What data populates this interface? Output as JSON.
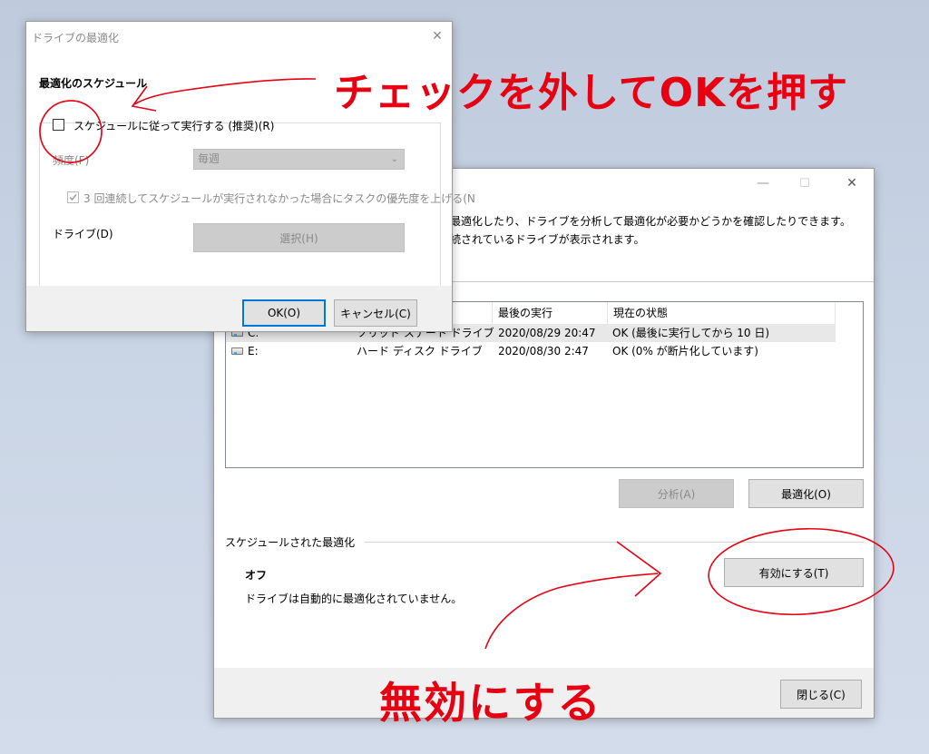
{
  "main_window": {
    "minimize_glyph": "—",
    "maximize_glyph": "☐",
    "close_glyph": "✕",
    "description_line1": "を最適化したり、ドライブを分析して最適化が必要かどうかを確認したりできます。",
    "description_line2": "接続されているドライブが表示されます。",
    "columns": {
      "last_run": "最後の実行",
      "current_status": "現在の状態"
    },
    "drives": [
      {
        "drive": "C:",
        "media_type": "ソリッド ステート ドライブ",
        "last_run": "2020/08/29 20:47",
        "status": "OK (最後に実行してから 10 日)"
      },
      {
        "drive": "E:",
        "media_type": "ハード ディスク ドライブ",
        "last_run": "2020/08/30 2:47",
        "status": "OK (0% が断片化しています)"
      }
    ],
    "analyze_label": "分析(A)",
    "optimize_label": "最適化(O)",
    "scheduled_section_label": "スケジュールされた最適化",
    "schedule_state": "オフ",
    "schedule_description": "ドライブは自動的に最適化されていません。",
    "enable_label": "有効にする(T)",
    "close_label": "閉じる(C)"
  },
  "schedule_dialog": {
    "title": "ドライブの最適化",
    "close_glyph": "✕",
    "section_heading": "最適化のスケジュール",
    "run_on_schedule_label": "スケジュールに従って実行する (推奨)(R)",
    "frequency_label": "頻度(F)",
    "frequency_value": "毎週",
    "priority_label": "3 回連続してスケジュールが実行されなかった場合にタスクの優先度を上げる(N",
    "drives_label": "ドライブ(D)",
    "select_label": "選択(H)",
    "ok_label": "OK(O)",
    "cancel_label": "キャンセル(C)"
  },
  "annotations": {
    "uncheck_instruction": "チェックを外してOKを押す",
    "disable_instruction": "無効にする",
    "color": "#e60012"
  }
}
